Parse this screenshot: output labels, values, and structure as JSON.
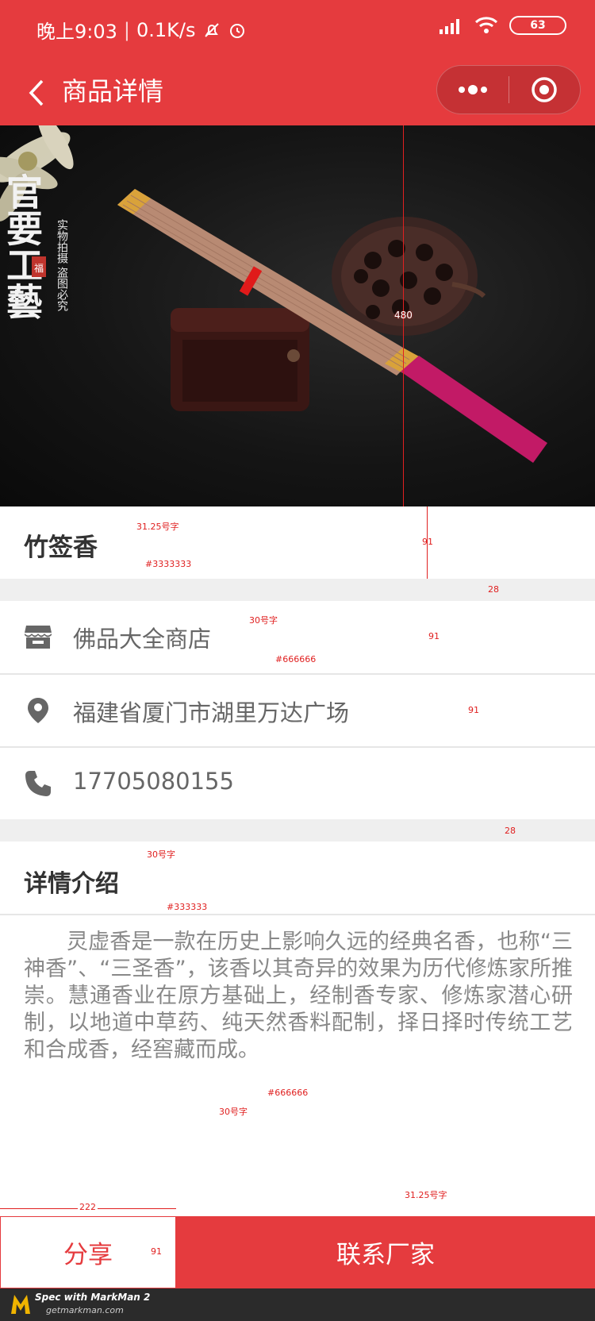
{
  "statusbar": {
    "time": "晚上9:03",
    "speed": "0.1K/s",
    "battery": "63"
  },
  "nav": {
    "title": "商品详情"
  },
  "product": {
    "name": "竹签香"
  },
  "shop": {
    "name": "佛品大全商店",
    "address": "福建省厦门市湖里万达广场",
    "phone": "17705080155"
  },
  "detail": {
    "heading": "详情介绍",
    "body": "灵虚香是一款在历史上影响久远的经典名香，也称“三神香”、“三圣香”，该香以其奇异的效果为历代修炼家所推崇。慧通香业在原方基础上，经制香专家、修炼家潜心研制，以地道中草药、纯天然香料配制，择日择时传统工艺和合成香，经窖藏而成。"
  },
  "bottom": {
    "share_label": "分享",
    "contact_label": "联系厂家"
  },
  "hero": {
    "calligraphy": "官要工藝",
    "seal": "福",
    "note1": "实物拍摄",
    "note2": "盗图必究"
  },
  "annotations": {
    "a_480": "480",
    "a_91_1": "91",
    "a_28_1": "28",
    "a_91_2": "91",
    "a_91_3": "91",
    "a_28_2": "28",
    "a_222": "222",
    "a_91_4": "91",
    "title_size": "31.25号字",
    "title_color": "#3333333",
    "shop_size": "30号字",
    "shop_color": "#666666",
    "detail_size": "30号字",
    "detail_color": "#333333",
    "body_color": "#666666",
    "body_size": "30号字",
    "contact_size": "31.25号字"
  },
  "brand": {
    "title": "Spec with MarkMan 2",
    "sub": "getmarkman.com"
  },
  "colors": {
    "brand": "#e53b3e",
    "title": "#333333",
    "info": "#666666",
    "divider": "#efefef"
  }
}
